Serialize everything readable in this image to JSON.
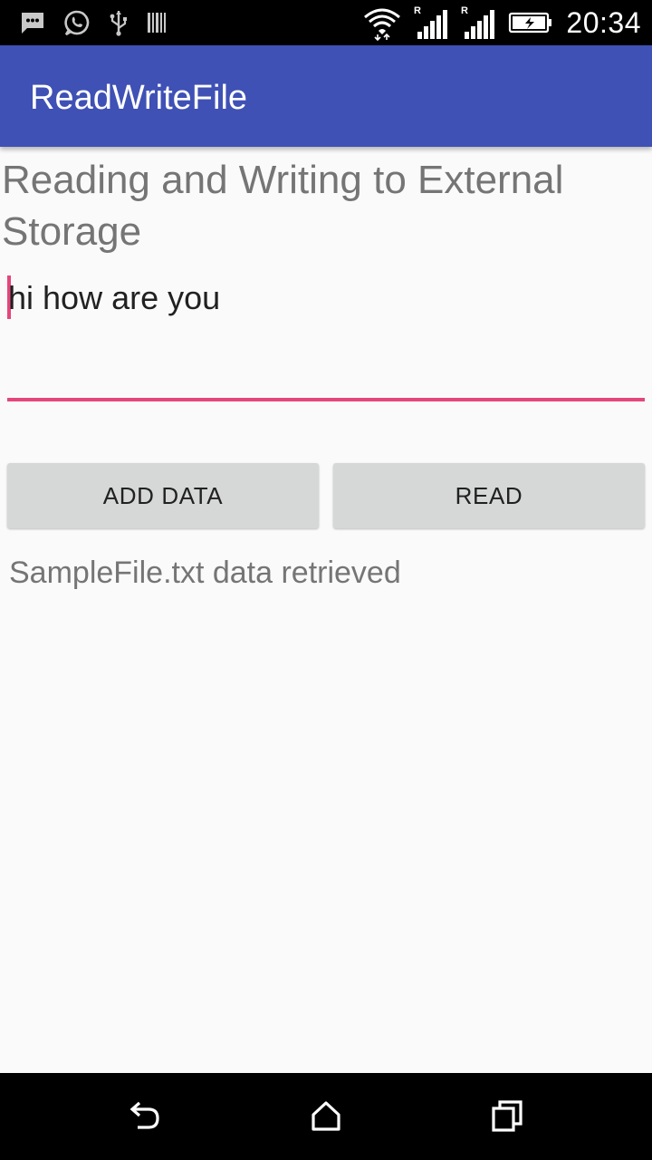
{
  "status_bar": {
    "time": "20:34",
    "icons": [
      "message-icon",
      "whatsapp-icon",
      "usb-icon",
      "barcode-icon",
      "wifi-icon",
      "signal-icon",
      "signal-icon",
      "battery-charging-icon"
    ],
    "roaming_label": "R"
  },
  "app_bar": {
    "title": "ReadWriteFile",
    "color": "#3f51b5"
  },
  "main": {
    "heading": "Reading and Writing to External Storage",
    "input_value": "hi how are you",
    "add_button_label": "ADD DATA",
    "read_button_label": "READ",
    "result_text": "SampleFile.txt data retrieved",
    "accent_color": "#e4467c"
  },
  "nav_bar": {
    "icons": [
      "back-icon",
      "home-icon",
      "recent-apps-icon"
    ]
  }
}
